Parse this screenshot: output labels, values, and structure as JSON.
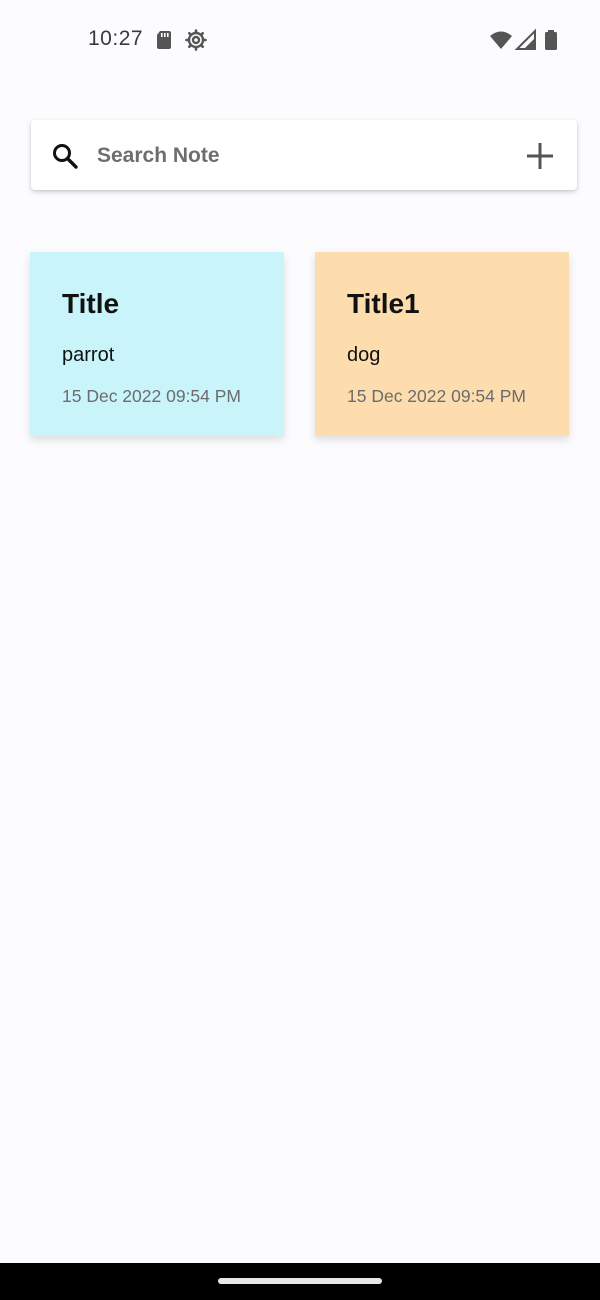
{
  "status_bar": {
    "time": "10:27",
    "icons_left": [
      "sd-card-icon",
      "settings-gear-icon"
    ],
    "icons_right": [
      "wifi-icon",
      "signal-icon",
      "battery-icon"
    ]
  },
  "search": {
    "placeholder": "Search Note",
    "value": "",
    "search_icon": "search-icon",
    "add_icon": "add-icon"
  },
  "notes": [
    {
      "title": "Title",
      "body": "parrot",
      "date": "15 Dec 2022 09:54 PM",
      "color": "#c8f4fa"
    },
    {
      "title": "Title1",
      "body": "dog",
      "date": "15 Dec 2022 09:54 PM",
      "color": "#fddcae"
    }
  ],
  "colors": {
    "background": "#fcfbfe",
    "nav_bar": "#000000",
    "text_primary": "#111111",
    "text_secondary": "#6c6c6c"
  }
}
